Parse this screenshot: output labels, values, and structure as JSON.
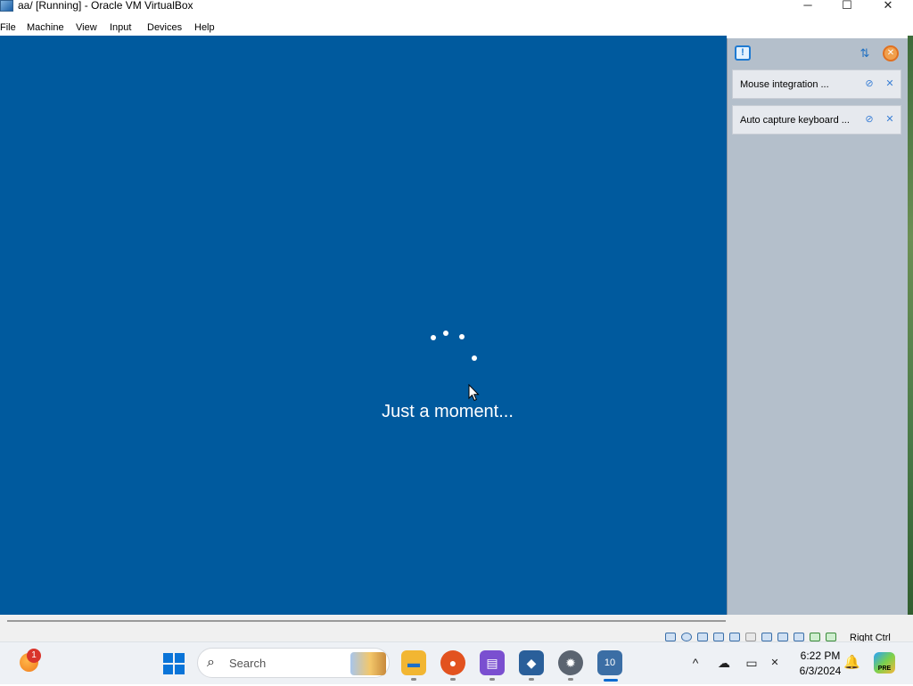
{
  "window": {
    "title": "aa/ [Running] - Oracle VM VirtualBox",
    "icon": "virtualbox-icon",
    "controls": {
      "minimize": "─",
      "maximize": "☐",
      "close": "✕"
    }
  },
  "menu": {
    "items": [
      "File",
      "Machine",
      "View",
      "Input",
      "Devices",
      "Help"
    ]
  },
  "vm_screen": {
    "status_text": "Just a moment...",
    "background_color": "#005a9e"
  },
  "notifications": {
    "header_icons": {
      "main": "notification-icon",
      "sort": "sort-icon",
      "close_all": "close-all-icon"
    },
    "main_glyph": "!",
    "sort_glyph": "⇅",
    "close_all_glyph": "✕",
    "items": [
      {
        "label": "Mouse integration ...",
        "icons": [
          "mute-icon",
          "close-icon"
        ],
        "glyphs": [
          "⊘",
          "✕"
        ]
      },
      {
        "label": "Auto capture keyboard ...",
        "icons": [
          "mute-icon",
          "close-icon"
        ],
        "glyphs": [
          "⊘",
          "✕"
        ]
      }
    ]
  },
  "status_bar": {
    "host_key": "Right Ctrl",
    "icons": [
      "hard-disk-icon",
      "optical-drive-icon",
      "audio-icon",
      "network-icon",
      "usb-icon",
      "shared-folder-icon",
      "display-icon",
      "recording-icon",
      "cpu-icon",
      "mouse-integration-icon",
      "keyboard-icon"
    ]
  },
  "taskbar": {
    "widgets_badge": "1",
    "search_placeholder": "Search",
    "search_glyph": "⌕",
    "apps": [
      {
        "name": "file-explorer-icon",
        "glyph": "▬",
        "color": "#f2b632"
      },
      {
        "name": "firefox-icon",
        "glyph": "●",
        "color": "#e2521f"
      },
      {
        "name": "notes-app-icon",
        "glyph": "▤",
        "color": "#7a4fd0"
      },
      {
        "name": "cube-app-icon",
        "glyph": "◆",
        "color": "#2a5f9a"
      },
      {
        "name": "settings-icon",
        "glyph": "✹",
        "color": "#5b6470"
      },
      {
        "name": "virtualbox-icon",
        "glyph": "10",
        "color": "#3b6ea5"
      }
    ],
    "tray": {
      "chevron": "^",
      "cloud": "☁",
      "display": "▭",
      "network": "✕",
      "bell": "🔔",
      "copilot": "PRE"
    },
    "time": "6:22 PM",
    "date": "6/3/2024"
  }
}
